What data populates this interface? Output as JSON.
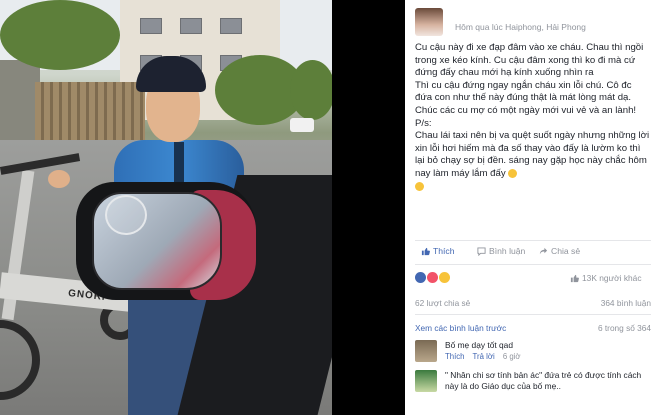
{
  "post": {
    "meta": "Hôm qua lúc Haiphong, Hải Phong",
    "body_lines": [
      "Cu cậu này đi xe đạp đâm vào xe cháu. Chau thì ngồi trong xe kéo kính. Cu cậu đâm xong thì ko đi mà cứ đứng đấy chau mới hạ kính xuống nhìn ra",
      "Thì cu cậu đứng ngay ngắn cháu xin lỗi chú. Cô đc đứa con như thế này đúng thật là mát lòng mát dạ.",
      "Chúc các cu mợ có một ngày mới vui vẻ và an lành!",
      "P/s:",
      "Chau lái taxi nên bị va quệt suốt ngày nhưng những lời xin lỗi hơi hiếm mà đa số thay vào đấy là lườm        ko thì lại bỏ chạy sợ bị đền. sáng nay gặp       học này chắc hôm nay làm máy lắm đấy"
    ],
    "extra_line": "",
    "emoji_names": [
      "smile-emoji",
      "grin-emoji"
    ]
  },
  "actions": {
    "like": "Thích",
    "comment": "Bình luận",
    "share": "Chia sẻ"
  },
  "reactions": {
    "count": "13K người khác"
  },
  "stats": {
    "shares": "62 lượt chia sẻ",
    "comments": "364 bình luận"
  },
  "prev_comments": {
    "label": "Xem các bình luận trước",
    "count": "6 trong số 364"
  },
  "comments": [
    {
      "text": "Bố mẹ dạy tốt qad",
      "like": "Thích",
      "reply": "Trả lời",
      "time": "6 giờ"
    },
    {
      "text": "\" Nhân chi sơ tính bản ác\" đứa trẻ có được tính cách này là do Giáo dục của bố mẹ..",
      "like": "",
      "reply": "",
      "time": ""
    }
  ],
  "colors": {
    "accent": "#4267b2",
    "muted": "#90949c",
    "text": "#1d2129"
  }
}
